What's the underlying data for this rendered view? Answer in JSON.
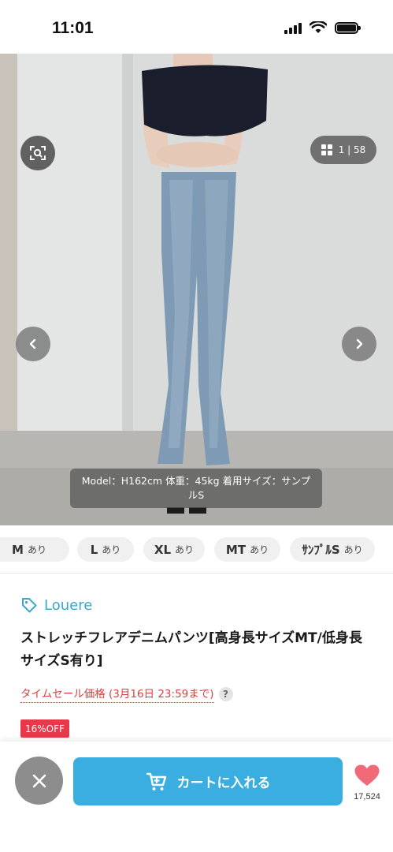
{
  "status_bar": {
    "time": "11:01"
  },
  "gallery": {
    "counter": "1 | 58",
    "caption": "Model：H162cm 体重：45kg 着用サイズ：サンプルS"
  },
  "sizes": [
    {
      "size": "M",
      "stock": "あり"
    },
    {
      "size": "L",
      "stock": "あり"
    },
    {
      "size": "XL",
      "stock": "あり"
    },
    {
      "size": "MT",
      "stock": "あり"
    },
    {
      "size": "ｻﾝﾌﾟﾙS",
      "stock": "あり"
    }
  ],
  "product": {
    "brand": "Louere",
    "title": "ストレッチフレアデニムパンツ[高身長サイズMT/低身長サイズS有り]",
    "sale_label": "タイムセール価格 (3月16日 23:59まで)",
    "help": "?",
    "discount_badge": "16%OFF"
  },
  "actions": {
    "cart_label": "カートに入れる",
    "favorite_count": "17,524"
  },
  "colors": {
    "accent": "#3aaee1",
    "brand": "#3ba7cc",
    "sale": "#d94040",
    "badge": "#e8394a",
    "heart": "#f06a78"
  }
}
